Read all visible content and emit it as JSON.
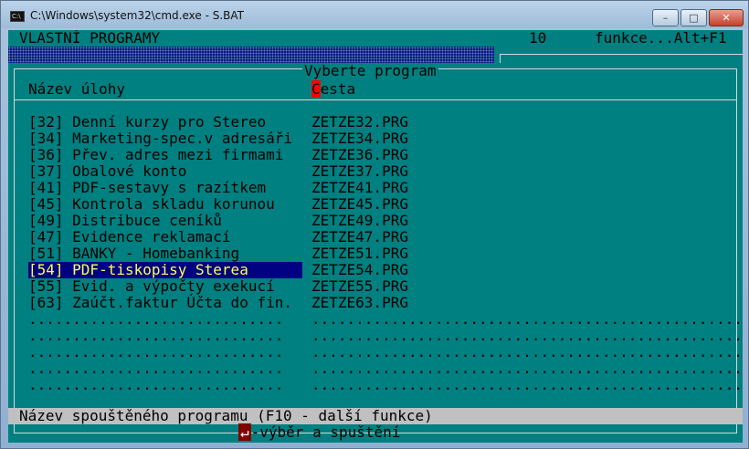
{
  "window": {
    "title": "C:\\Windows\\system32\\cmd.exe - S.BAT",
    "icon": "C:\\",
    "min_icon": "minimize-icon",
    "max_icon": "maximize-icon",
    "close_icon": "close-icon"
  },
  "header": {
    "left": "VLASTNÍ PROGRAMY",
    "number": "10",
    "right": "funkce...Alt+F1"
  },
  "panel": {
    "title": "Vyberte program",
    "col_task": "Název úlohy",
    "col_path_cursor": "C",
    "col_path_rest": "esta"
  },
  "programs": [
    {
      "name": "[32] Denní kurzy pro Stereo",
      "path": "ZETZE32.PRG"
    },
    {
      "name": "[34] Marketing-spec.v adresáři",
      "path": "ZETZE34.PRG"
    },
    {
      "name": "[36] Přev. adres mezi firmami",
      "path": "ZETZE36.PRG"
    },
    {
      "name": "[37] Obalové konto",
      "path": "ZETZE37.PRG"
    },
    {
      "name": "[41] PDF-sestavy s razítkem",
      "path": "ZETZE41.PRG"
    },
    {
      "name": "[45] Kontrola skladu korunou",
      "path": "ZETZE45.PRG"
    },
    {
      "name": "[49] Distribuce ceníků",
      "path": "ZETZE49.PRG"
    },
    {
      "name": "[47] Evidence reklamací",
      "path": "ZETZE47.PRG"
    },
    {
      "name": "[51] BANKY - Homebanking",
      "path": "ZETZE51.PRG"
    },
    {
      "name": "[54] PDF-tiskopisy Sterea",
      "path": "ZETZE54.PRG",
      "selected": true
    },
    {
      "name": "[55] Evid. a výpočty exekucí",
      "path": "ZETZE55.PRG"
    },
    {
      "name": "[63] Zaúčt.faktur Účta do fin.",
      "path": "ZETZE63.PRG"
    }
  ],
  "empty_rows": {
    "name": ".............................",
    "path": "...................................................",
    "count": 5
  },
  "status": {
    "text": "Název spouštěného programu (F10 - další funkce)",
    "enter_key": "↵",
    "hint": "-výběr a spuštění"
  }
}
